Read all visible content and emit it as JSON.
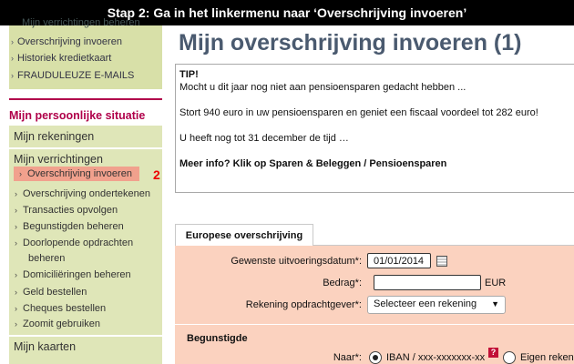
{
  "banner": "Stap 2: Ga in het linkermenu naar ‘Overschrijving invoeren’",
  "sidebar": {
    "cutoff_item": "Mijn verrichtingen beheren",
    "top_items": [
      "Overschrijving invoeren",
      "Historiek kredietkaart",
      "FRAUDULEUZE E-MAILS"
    ],
    "section_title": "Mijn persoonlijke situatie",
    "headers": {
      "rekeningen": "Mijn rekeningen",
      "verrichtingen": "Mijn verrichtingen",
      "kaarten": "Mijn kaarten"
    },
    "sub_items": [
      "Overschrijving invoeren",
      "Overschrijving ondertekenen",
      "Transacties opvolgen",
      "Begunstigden beheren",
      "Doorlopende opdrachten",
      "beheren",
      "Domiciliëringen beheren",
      "Geld bestellen",
      "Cheques bestellen",
      "Zoomit gebruiken"
    ],
    "step_marker": "2"
  },
  "main": {
    "title": "Mijn overschrijving invoeren (1)",
    "tip": {
      "heading": "TIP!",
      "line1": "Mocht u dit jaar nog niet aan pensioensparen gedacht hebben ...",
      "line2": "Stort 940 euro in uw pensioensparen en geniet een fiscaal voordeel tot 282 euro!",
      "line3": "U heeft nog tot 31 december de tijd …",
      "line4": "Meer info? Klik op Sparen & Beleggen / Pensioensparen"
    },
    "tab_label": "Europese overschrijving",
    "form": {
      "date_label": "Gewenste uitvoeringsdatum*:",
      "date_value": "01/01/2014",
      "amount_label": "Bedrag*:",
      "amount_value": "",
      "currency": "EUR",
      "account_label": "Rekening opdrachtgever*:",
      "account_selected": "Selecteer een rekening",
      "beneficiary_heading": "Begunstigde",
      "to_label": "Naar*:",
      "radio1": "IBAN / xxx-xxxxxxx-xx",
      "radio2": "Eigen reken",
      "help": "?"
    }
  }
}
